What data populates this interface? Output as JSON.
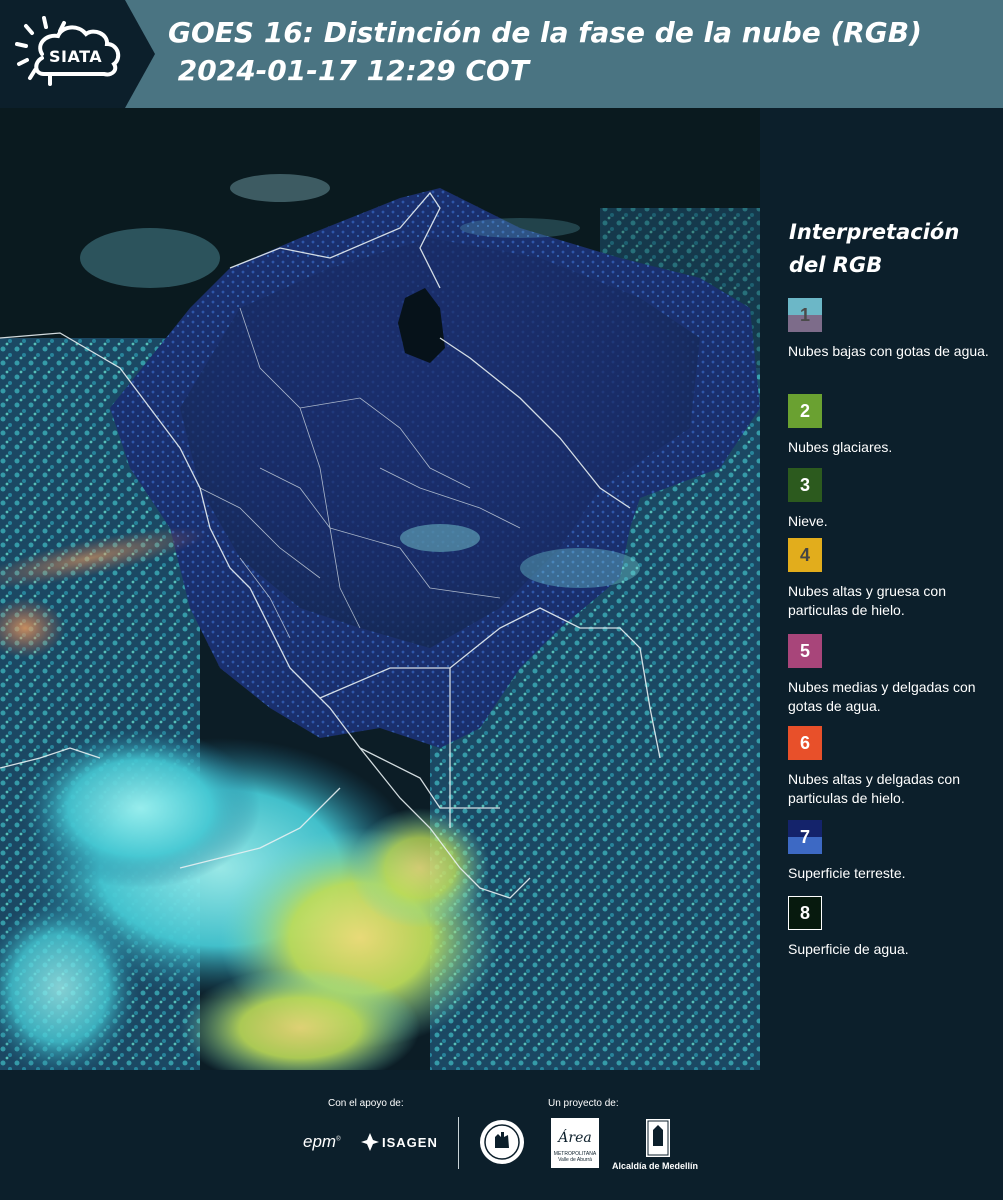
{
  "header": {
    "logo_text": "SIATA",
    "title_line1": "GOES 16: Distinción de la fase de la nube (RGB)",
    "title_line2": " 2024-01-17 12:29 COT"
  },
  "legend": {
    "title": "Interpretación del RGB",
    "items": [
      {
        "num": "1",
        "label": "Nubes bajas con gotas de agua.",
        "color_top": "#6cb7c7",
        "color_bottom": "#7d6c8a",
        "text_color": "#4a4a4a"
      },
      {
        "num": "2",
        "label": "Nubes glaciares.",
        "color_top": "#6aa131",
        "color_bottom": "#6aa131",
        "text_color": "#ffffff"
      },
      {
        "num": "3",
        "label": "Nieve.",
        "color_top": "#2c5a1e",
        "color_bottom": "#2c5a1e",
        "text_color": "#ffffff"
      },
      {
        "num": "4",
        "label": "Nubes altas y gruesa con particulas de hielo.",
        "color_top": "#e2ad1c",
        "color_bottom": "#e2ad1c",
        "text_color": "#444444"
      },
      {
        "num": "5",
        "label": "Nubes medias y delgadas con gotas de agua.",
        "color_top": "#a8457a",
        "color_bottom": "#a8457a",
        "text_color": "#ffffff"
      },
      {
        "num": "6",
        "label": "Nubes altas y delgadas con particulas de hielo.",
        "color_top": "#e8502a",
        "color_bottom": "#e8502a",
        "text_color": "#ffffff"
      },
      {
        "num": "7",
        "label": "Superficie terreste.",
        "color_top": "#14236b",
        "color_bottom": "#3d69c4",
        "text_color": "#ffffff"
      },
      {
        "num": "8",
        "label": "Superficie de agua.",
        "color_top": "#071a0e",
        "color_bottom": "#071a0e",
        "text_color": "#ffffff"
      }
    ]
  },
  "footer": {
    "support_label": "Con el apoyo de:",
    "project_label": "Un proyecto de:",
    "epm": "epm",
    "isagen": "ISAGEN",
    "area_brand": "Área",
    "area_sub1": "METROPOLITANA",
    "area_sub2": "Valle de Aburrá",
    "alcaldia": "Alcaldía de Medellín"
  },
  "colors": {
    "header_bg": "#4a7482",
    "logo_bg": "#0c1f2b",
    "panel_bg": "#0c1f2b"
  }
}
